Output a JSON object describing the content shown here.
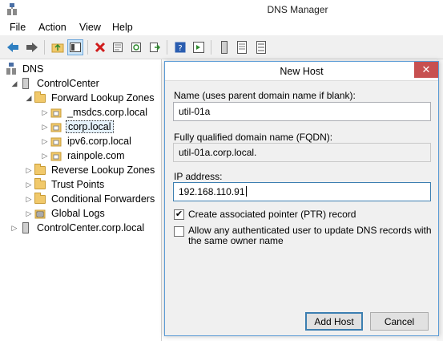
{
  "window": {
    "title": "DNS Manager"
  },
  "menu": [
    "File",
    "Action",
    "View",
    "Help"
  ],
  "tree": {
    "items": [
      {
        "label": "DNS",
        "icon": "dns-icon",
        "arrow": ""
      },
      {
        "label": "ControlCenter",
        "icon": "server-icon",
        "arrow": "◢"
      },
      {
        "label": "Forward Lookup Zones",
        "icon": "folder-icon",
        "arrow": "◢"
      },
      {
        "label": "_msdcs.corp.local",
        "icon": "zone-icon",
        "arrow": "▷"
      },
      {
        "label": "corp.local",
        "icon": "zone-icon",
        "arrow": "▷"
      },
      {
        "label": "ipv6.corp.local",
        "icon": "zone-icon",
        "arrow": "▷"
      },
      {
        "label": "rainpole.com",
        "icon": "zone-icon",
        "arrow": "▷"
      },
      {
        "label": "Reverse Lookup Zones",
        "icon": "folder-icon",
        "arrow": "▷"
      },
      {
        "label": "Trust Points",
        "icon": "folder-icon",
        "arrow": "▷"
      },
      {
        "label": "Conditional Forwarders",
        "icon": "folder-icon",
        "arrow": "▷"
      },
      {
        "label": "Global Logs",
        "icon": "logs-icon",
        "arrow": "▷"
      },
      {
        "label": "ControlCenter.corp.local",
        "icon": "server-icon",
        "arrow": "▷"
      }
    ]
  },
  "dialog": {
    "title": "New Host",
    "name_label": "Name (uses parent domain name if blank):",
    "name_value": "util-01a",
    "fqdn_label": "Fully qualified domain name (FQDN):",
    "fqdn_value": "util-01a.corp.local.",
    "ip_label": "IP address:",
    "ip_value": "192.168.110.91",
    "ptr_label": "Create associated pointer (PTR) record",
    "ptr_checked": true,
    "allow_label": "Allow any authenticated user to update DNS records with the same owner name",
    "allow_checked": false,
    "add_button": "Add Host",
    "cancel_button": "Cancel"
  }
}
